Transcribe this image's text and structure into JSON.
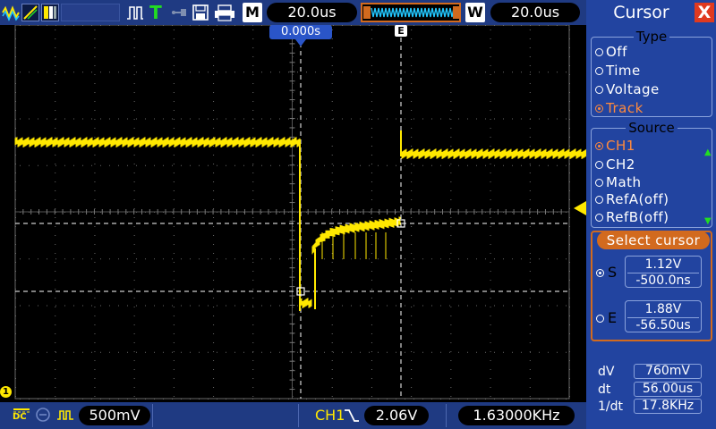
{
  "toolbar": {
    "timebase": "20.0us",
    "m_label": "M",
    "w_label": "W",
    "window_timebase": "20.0us",
    "trigger_letter": "T"
  },
  "scope": {
    "trigger_time_marker": "0.000s",
    "cursor_e_marker": "E",
    "channel_ground_marker": "1"
  },
  "bottombar": {
    "coupling": "DC",
    "volts_per_div": "500mV",
    "trigger_source": "CH1",
    "trigger_level": "2.06V",
    "frequency": "1.63000KHz"
  },
  "menu": {
    "title": "Cursor",
    "close_glyph": "X",
    "type_group_title": "Type",
    "type_options": [
      {
        "label": "Off",
        "selected": false
      },
      {
        "label": "Time",
        "selected": false
      },
      {
        "label": "Voltage",
        "selected": false
      },
      {
        "label": "Track",
        "selected": true
      }
    ],
    "source_group_title": "Source",
    "source_options": [
      {
        "label": "CH1",
        "selected": true
      },
      {
        "label": "CH2",
        "selected": false
      },
      {
        "label": "Math",
        "selected": false
      },
      {
        "label": "RefA(off)",
        "selected": false
      },
      {
        "label": "RefB(off)",
        "selected": false
      }
    ],
    "select_cursor_title": "Select cursor",
    "cursor_s": {
      "label": "S",
      "selected": true,
      "voltage": "1.12V",
      "time": "-500.0ns"
    },
    "cursor_e": {
      "label": "E",
      "selected": false,
      "voltage": "1.88V",
      "time": "-56.50us"
    },
    "measurements": [
      {
        "label": "dV",
        "value": "760mV"
      },
      {
        "label": "dt",
        "value": "56.00us"
      },
      {
        "label": "1/dt",
        "value": "17.8KHz"
      }
    ]
  },
  "colors": {
    "trace": "#ffe800",
    "panel": "#2244a0",
    "accent": "#d26a1e",
    "toolbar": "#1f3a82"
  }
}
